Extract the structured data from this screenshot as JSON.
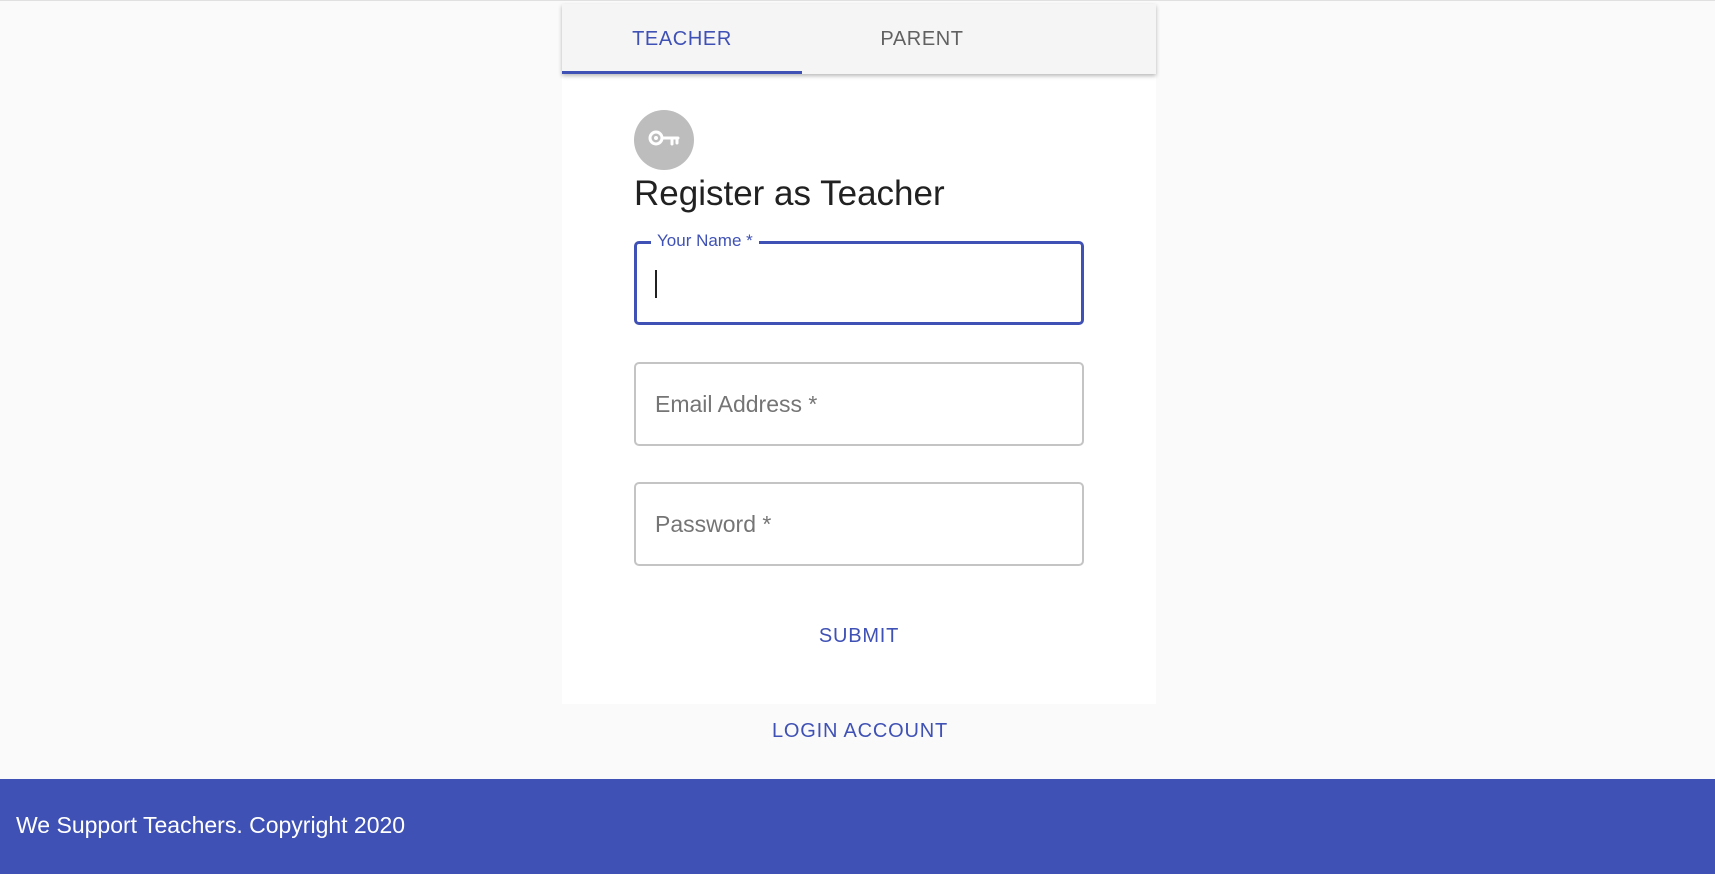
{
  "tabs": {
    "teacher": {
      "label": "TEACHER"
    },
    "parent": {
      "label": "PARENT"
    }
  },
  "form": {
    "icon": "key-icon",
    "title": "Register as Teacher",
    "name_field": {
      "label": "Your Name *",
      "value": ""
    },
    "email_field": {
      "placeholder": "Email Address *",
      "value": ""
    },
    "password_field": {
      "placeholder": "Password *",
      "value": ""
    },
    "submit_label": "SUBMIT"
  },
  "login_label": "LOGIN ACCOUNT",
  "footer": {
    "text": "We Support Teachers. Copyright 2020"
  },
  "colors": {
    "accent": "#3f51b5",
    "avatar_bg": "#bdbdbd",
    "page_bg": "#fafafa"
  }
}
